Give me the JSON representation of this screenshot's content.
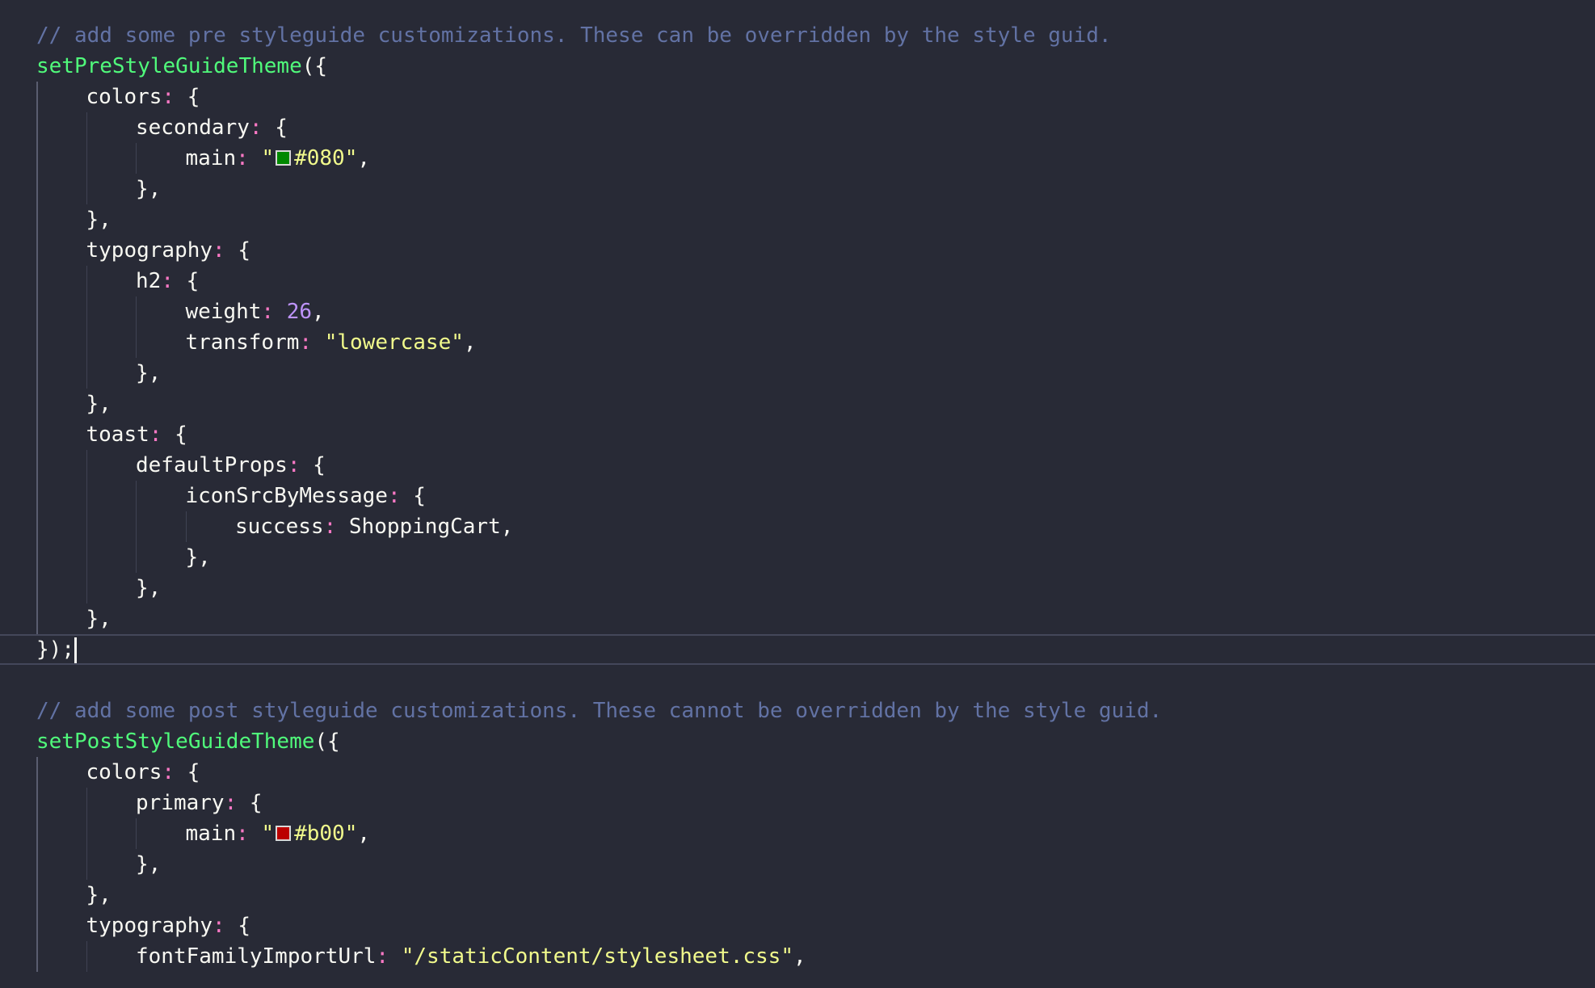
{
  "editor": {
    "lines": [
      {
        "guides": 0,
        "tokens": [
          {
            "t": "// add some pre styleguide customizations. These can be overridden by the style guid.",
            "c": "comment"
          }
        ]
      },
      {
        "guides": 0,
        "tokens": [
          {
            "t": "setPreStyleGuideTheme",
            "c": "func"
          },
          {
            "t": "(",
            "c": "b1"
          },
          {
            "t": "{",
            "c": "b2"
          }
        ]
      },
      {
        "guides": 1,
        "tokens": [
          {
            "t": "colors",
            "c": "key"
          },
          {
            "t": ":",
            "c": "punct"
          },
          {
            "t": " "
          },
          {
            "t": "{",
            "c": "b3"
          }
        ]
      },
      {
        "guides": 2,
        "tokens": [
          {
            "t": "secondary",
            "c": "key"
          },
          {
            "t": ":",
            "c": "punct"
          },
          {
            "t": " "
          },
          {
            "t": "{",
            "c": "b1"
          }
        ]
      },
      {
        "guides": 3,
        "tokens": [
          {
            "t": "main",
            "c": "key"
          },
          {
            "t": ":",
            "c": "punct"
          },
          {
            "t": " "
          },
          {
            "t": "\"",
            "c": "str"
          },
          {
            "swatch": "#008800"
          },
          {
            "t": "#080\"",
            "c": "str"
          },
          {
            "t": ","
          }
        ]
      },
      {
        "guides": 2,
        "tokens": [
          {
            "t": "}",
            "c": "b1"
          },
          {
            "t": ","
          }
        ]
      },
      {
        "guides": 1,
        "tokens": [
          {
            "t": "}",
            "c": "b3"
          },
          {
            "t": ","
          }
        ]
      },
      {
        "guides": 1,
        "tokens": [
          {
            "t": "typography",
            "c": "key"
          },
          {
            "t": ":",
            "c": "punct"
          },
          {
            "t": " "
          },
          {
            "t": "{",
            "c": "b3"
          }
        ]
      },
      {
        "guides": 2,
        "tokens": [
          {
            "t": "h2",
            "c": "key"
          },
          {
            "t": ":",
            "c": "punct"
          },
          {
            "t": " "
          },
          {
            "t": "{",
            "c": "b1"
          }
        ]
      },
      {
        "guides": 3,
        "tokens": [
          {
            "t": "weight",
            "c": "key"
          },
          {
            "t": ":",
            "c": "punct"
          },
          {
            "t": " "
          },
          {
            "t": "26",
            "c": "num"
          },
          {
            "t": ","
          }
        ]
      },
      {
        "guides": 3,
        "tokens": [
          {
            "t": "transform",
            "c": "key"
          },
          {
            "t": ":",
            "c": "punct"
          },
          {
            "t": " "
          },
          {
            "t": "\"lowercase\"",
            "c": "str"
          },
          {
            "t": ","
          }
        ]
      },
      {
        "guides": 2,
        "tokens": [
          {
            "t": "}",
            "c": "b1"
          },
          {
            "t": ","
          }
        ]
      },
      {
        "guides": 1,
        "tokens": [
          {
            "t": "}",
            "c": "b3"
          },
          {
            "t": ","
          }
        ]
      },
      {
        "guides": 1,
        "tokens": [
          {
            "t": "toast",
            "c": "key"
          },
          {
            "t": ":",
            "c": "punct"
          },
          {
            "t": " "
          },
          {
            "t": "{",
            "c": "b3"
          }
        ]
      },
      {
        "guides": 2,
        "tokens": [
          {
            "t": "defaultProps",
            "c": "key"
          },
          {
            "t": ":",
            "c": "punct"
          },
          {
            "t": " "
          },
          {
            "t": "{",
            "c": "b1"
          }
        ]
      },
      {
        "guides": 3,
        "tokens": [
          {
            "t": "iconSrcByMessage",
            "c": "key"
          },
          {
            "t": ":",
            "c": "punct"
          },
          {
            "t": " "
          },
          {
            "t": "{",
            "c": "b2"
          }
        ]
      },
      {
        "guides": 4,
        "tokens": [
          {
            "t": "success",
            "c": "key"
          },
          {
            "t": ":",
            "c": "punct"
          },
          {
            "t": " "
          },
          {
            "t": "ShoppingCart",
            "c": "ident"
          },
          {
            "t": ","
          }
        ]
      },
      {
        "guides": 3,
        "tokens": [
          {
            "t": "}",
            "c": "b2"
          },
          {
            "t": ","
          }
        ]
      },
      {
        "guides": 2,
        "tokens": [
          {
            "t": "}",
            "c": "b1"
          },
          {
            "t": ","
          }
        ]
      },
      {
        "guides": 1,
        "tokens": [
          {
            "t": "}",
            "c": "b3"
          },
          {
            "t": ","
          }
        ]
      },
      {
        "guides": 0,
        "current": true,
        "tokens": [
          {
            "t": "}",
            "c": "b2"
          },
          {
            "t": ")",
            "c": "b1"
          },
          {
            "t": ";"
          },
          {
            "caret": true
          }
        ]
      },
      {
        "guides": 0,
        "tokens": []
      },
      {
        "guides": 0,
        "tokens": [
          {
            "t": "// add some post styleguide customizations. These cannot be overridden by the style guid.",
            "c": "comment"
          }
        ]
      },
      {
        "guides": 0,
        "tokens": [
          {
            "t": "setPostStyleGuideTheme",
            "c": "func"
          },
          {
            "t": "(",
            "c": "b1"
          },
          {
            "t": "{",
            "c": "b2"
          }
        ]
      },
      {
        "guides": 1,
        "tokens": [
          {
            "t": "colors",
            "c": "key"
          },
          {
            "t": ":",
            "c": "punct"
          },
          {
            "t": " "
          },
          {
            "t": "{",
            "c": "b3"
          }
        ]
      },
      {
        "guides": 2,
        "tokens": [
          {
            "t": "primary",
            "c": "key"
          },
          {
            "t": ":",
            "c": "punct"
          },
          {
            "t": " "
          },
          {
            "t": "{",
            "c": "b1"
          }
        ]
      },
      {
        "guides": 3,
        "tokens": [
          {
            "t": "main",
            "c": "key"
          },
          {
            "t": ":",
            "c": "punct"
          },
          {
            "t": " "
          },
          {
            "t": "\"",
            "c": "str"
          },
          {
            "swatch": "#bb0000"
          },
          {
            "t": "#b00\"",
            "c": "str"
          },
          {
            "t": ","
          }
        ]
      },
      {
        "guides": 2,
        "tokens": [
          {
            "t": "}",
            "c": "b1"
          },
          {
            "t": ","
          }
        ]
      },
      {
        "guides": 1,
        "tokens": [
          {
            "t": "}",
            "c": "b3"
          },
          {
            "t": ","
          }
        ]
      },
      {
        "guides": 1,
        "tokens": [
          {
            "t": "typography",
            "c": "key"
          },
          {
            "t": ":",
            "c": "punct"
          },
          {
            "t": " "
          },
          {
            "t": "{",
            "c": "b3"
          }
        ]
      },
      {
        "guides": 2,
        "tokens": [
          {
            "t": "fontFamilyImportUrl",
            "c": "key"
          },
          {
            "t": ":",
            "c": "punct"
          },
          {
            "t": " "
          },
          {
            "t": "\"/staticContent/stylesheet.css\"",
            "c": "str"
          },
          {
            "t": ","
          }
        ]
      }
    ]
  },
  "colors": {
    "background": "#282a36",
    "comment": "#6272a4",
    "function": "#50fa7b",
    "string": "#f1fa8c",
    "number": "#bd93f9",
    "bracket_gold": "#ffd700",
    "bracket_orchid": "#da70d6",
    "bracket_blue": "#87cefa"
  }
}
